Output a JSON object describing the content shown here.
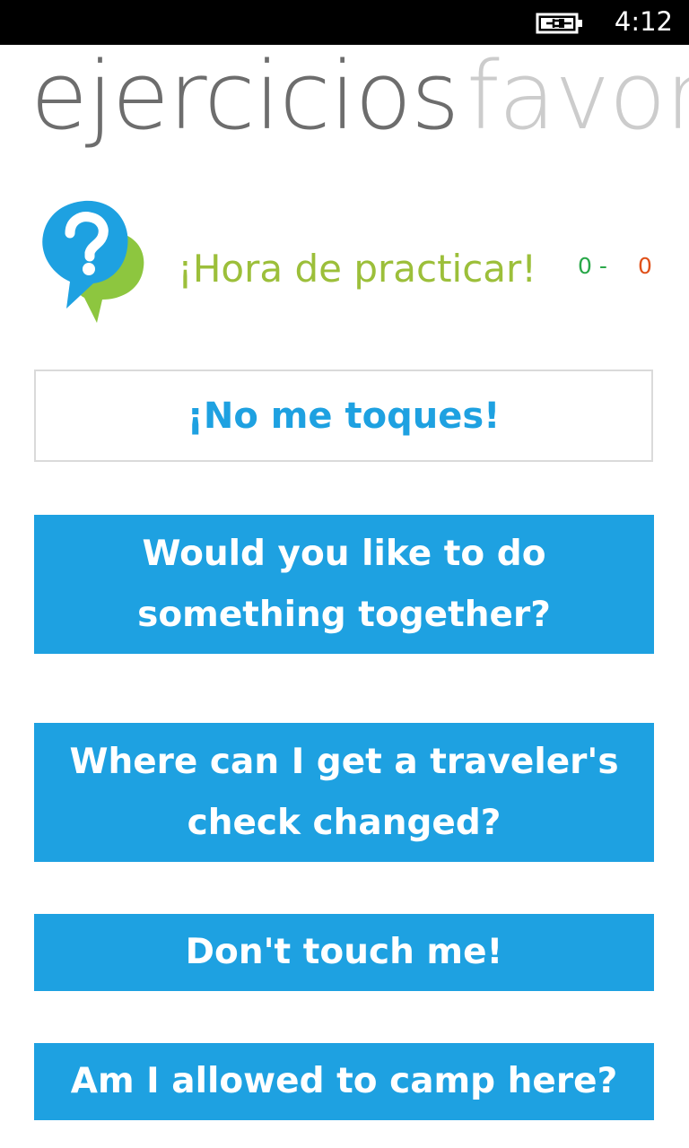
{
  "status_bar": {
    "time": "4:12",
    "battery_icon": "battery-charging-icon"
  },
  "pivot": {
    "active": "ejercicios",
    "next": "favor"
  },
  "header": {
    "logo_icon": "question-bubble-icon",
    "title": "¡Hora de practicar!",
    "score_correct": "0 -",
    "score_wrong": "0"
  },
  "exercise": {
    "prompt": "¡No me toques!",
    "answers": [
      "Would you like to do something together?",
      "Where can I get a traveler's check changed?",
      "Don't touch me!",
      "Am I allowed to camp here?"
    ]
  },
  "colors": {
    "accent_blue": "#1ea1e1",
    "title_green": "#9cbf3a",
    "score_green": "#2aa84a",
    "score_red": "#e0521b"
  }
}
